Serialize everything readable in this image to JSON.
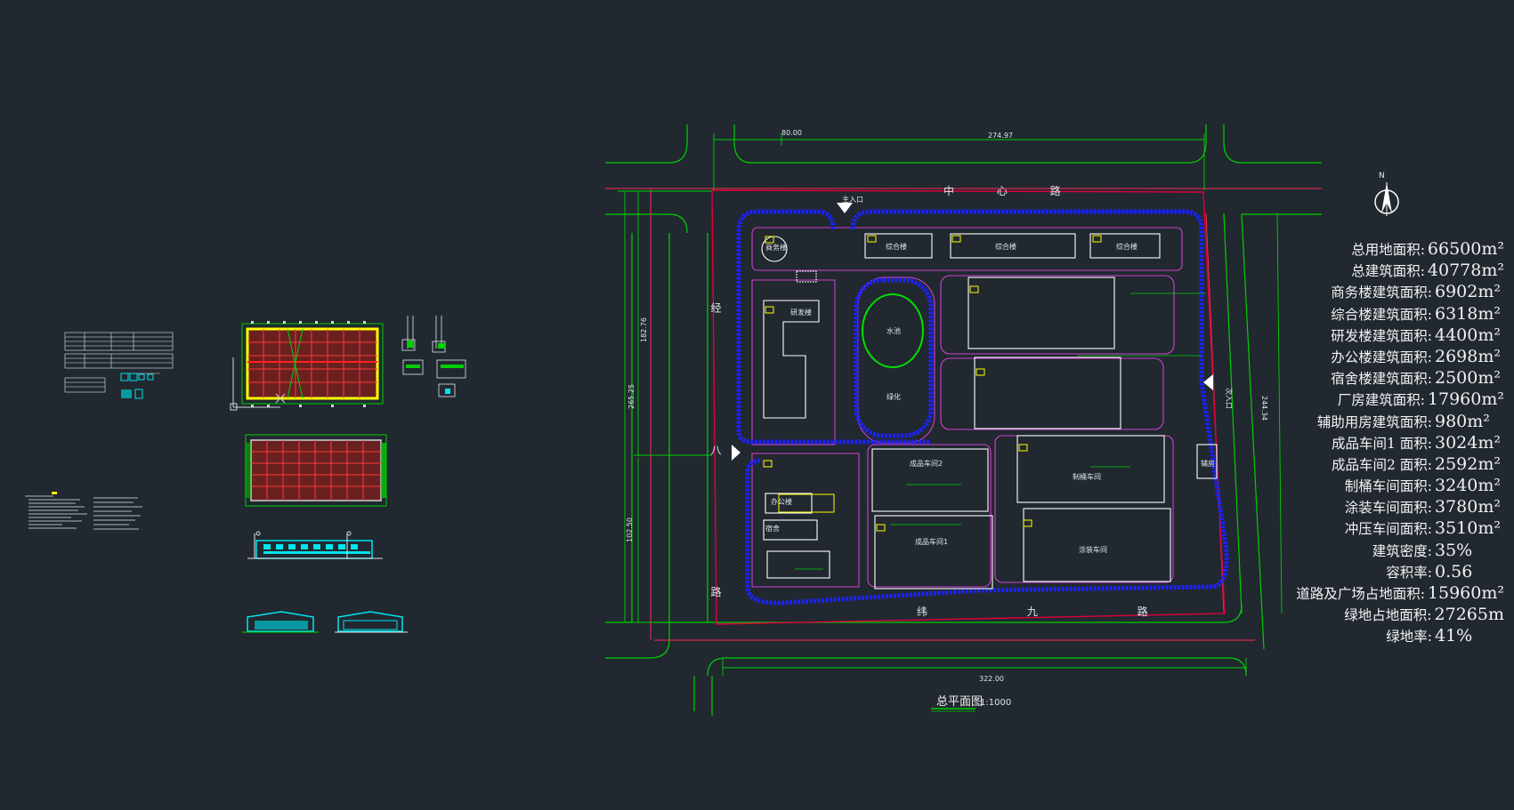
{
  "colors": {
    "background": "#212830",
    "road": "#00d000",
    "boundary": "#e0003c",
    "building": "#ffffff",
    "fence": "#1a22ff",
    "inner": "#d040d0",
    "tag": "#ffff00",
    "detail": "#00e5ee"
  },
  "plan": {
    "title": "总平面图",
    "scale": "1:1000",
    "north": "N",
    "roads": {
      "top_road": "中 心 路",
      "left_road": "经 八 路",
      "bottom_road": "纬 九 路"
    },
    "dims": [
      "80.00",
      "274.97",
      "322.00",
      "182.76",
      "265.25",
      "102.50",
      "244.34"
    ],
    "entrances": [
      "主入口",
      "次入口"
    ],
    "buildings": [
      {
        "tag": "F6",
        "label": "商务楼"
      },
      {
        "tag": "F3",
        "label": "综合楼"
      },
      {
        "tag": "F3",
        "label": "综合楼"
      },
      {
        "tag": "F3",
        "label": "综合楼"
      },
      {
        "tag": "F4",
        "label": "研发楼"
      },
      {
        "tag": "",
        "label": "水池"
      },
      {
        "tag": "",
        "label": "绿化"
      },
      {
        "tag": "F1",
        "label": "成品车间2"
      },
      {
        "tag": "F1",
        "label": "制桶车间"
      },
      {
        "tag": "F1",
        "label": "成品车间1"
      },
      {
        "tag": "F1",
        "label": "涂装车间"
      },
      {
        "tag": "",
        "label": "辅房"
      },
      {
        "tag": "F4",
        "label": "办公楼"
      },
      {
        "tag": "F4",
        "label": "宿舍"
      }
    ]
  },
  "stats": [
    {
      "label": "总用地面积:",
      "value": "66500m²"
    },
    {
      "label": "总建筑面积:",
      "value": "40778m²"
    },
    {
      "label": "商务楼建筑面积:",
      "value": "6902m²"
    },
    {
      "label": "综合楼建筑面积:",
      "value": "6318m²"
    },
    {
      "label": "研发楼建筑面积:",
      "value": "4400m²"
    },
    {
      "label": "办公楼建筑面积:",
      "value": "2698m²"
    },
    {
      "label": "宿舍楼建筑面积:",
      "value": "2500m²"
    },
    {
      "label": "厂房建筑面积:",
      "value": "17960m²"
    },
    {
      "label": "辅助用房建筑面积:",
      "value": "980m²"
    },
    {
      "label": "成品车间1 面积:",
      "value": "3024m²"
    },
    {
      "label": "成品车间2 面积:",
      "value": "2592m²"
    },
    {
      "label": "制桶车间面积:",
      "value": "3240m²"
    },
    {
      "label": "涂装车间面积:",
      "value": "3780m²"
    },
    {
      "label": "冲压车间面积:",
      "value": "3510m²"
    },
    {
      "label": "建筑密度:",
      "value": "35%"
    },
    {
      "label": "容积率:",
      "value": "0.56"
    },
    {
      "label": "道路及广场占地面积:",
      "value": "15960m²"
    },
    {
      "label": "绿地占地面积:",
      "value": "27265m"
    },
    {
      "label": "绿地率:",
      "value": "41%"
    }
  ]
}
